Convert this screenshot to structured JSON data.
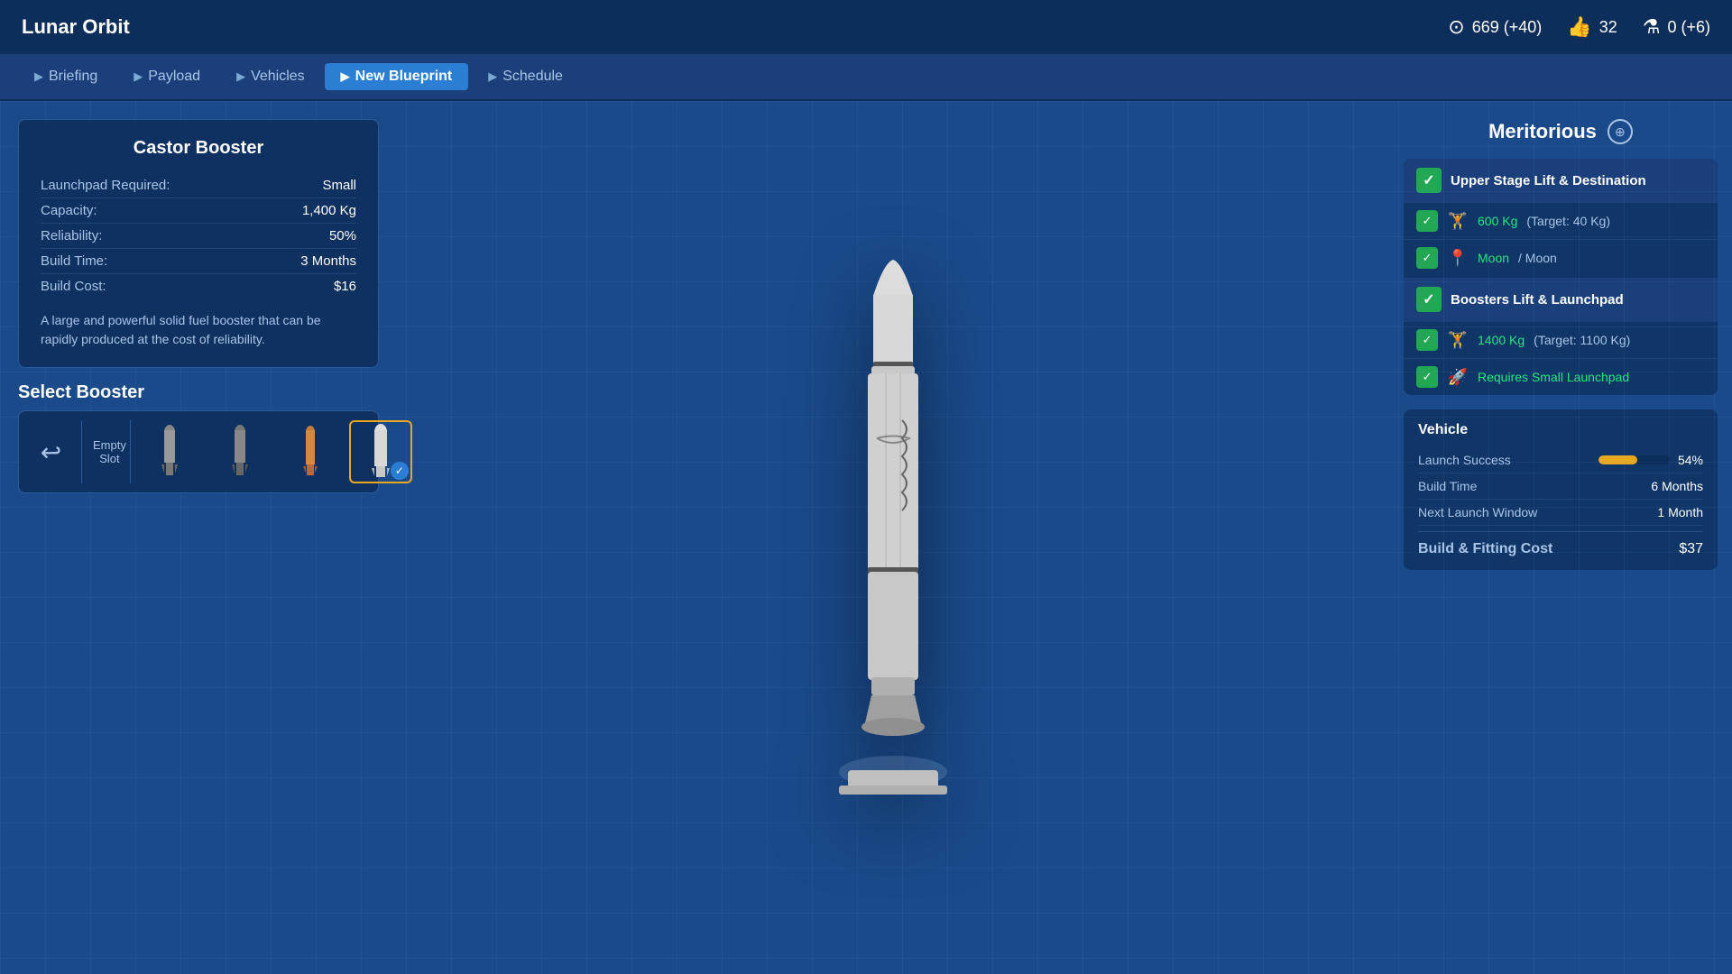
{
  "header": {
    "title": "Lunar Orbit",
    "resources": {
      "credits_icon": "⊙",
      "credits_value": "669 (+40)",
      "rep_icon": "👍",
      "rep_value": "32",
      "research_icon": "⚗",
      "research_value": "0 (+6)"
    }
  },
  "nav": {
    "items": [
      {
        "id": "briefing",
        "label": "Briefing",
        "active": false
      },
      {
        "id": "payload",
        "label": "Payload",
        "active": false
      },
      {
        "id": "vehicles",
        "label": "Vehicles",
        "active": false
      },
      {
        "id": "new-blueprint",
        "label": "New Blueprint",
        "active": true
      },
      {
        "id": "schedule",
        "label": "Schedule",
        "active": false
      }
    ]
  },
  "booster_info": {
    "title": "Castor Booster",
    "stats": [
      {
        "label": "Launchpad Required:",
        "value": "Small"
      },
      {
        "label": "Capacity:",
        "value": "1,400 Kg"
      },
      {
        "label": "Reliability:",
        "value": "50%"
      },
      {
        "label": "Build Time:",
        "value": "3 Months"
      },
      {
        "label": "Build Cost:",
        "value": "$16"
      }
    ],
    "description": "A large and powerful solid fuel booster that can be rapidly produced at the cost of reliability."
  },
  "select_booster": {
    "title": "Select Booster",
    "back_label": "↩",
    "empty_slot_label": "Empty Slot"
  },
  "mission_rating": {
    "title": "Meritorious",
    "info_icon": "⊕"
  },
  "requirements": [
    {
      "id": "upper-stage",
      "header": "Upper Stage Lift & Destination",
      "header_checked": true,
      "items": [
        {
          "icon": "🏋",
          "text": "600 Kg",
          "subtext": "(Target: 40 Kg)",
          "checked": true
        },
        {
          "icon": "📍",
          "text": "Moon",
          "subtext": "/ Moon",
          "checked": true
        }
      ]
    },
    {
      "id": "boosters",
      "header": "Boosters Lift & Launchpad",
      "header_checked": true,
      "items": [
        {
          "icon": "🏋",
          "text": "1400 Kg",
          "subtext": "(Target: 1100 Kg)",
          "checked": true
        },
        {
          "icon": "🚀",
          "text": "Requires Small Launchpad",
          "subtext": "",
          "checked": true
        }
      ]
    }
  ],
  "vehicle": {
    "title": "Vehicle",
    "stats": [
      {
        "label": "Launch Success",
        "value": "54%",
        "has_bar": true,
        "bar_pct": 54
      },
      {
        "label": "Build Time",
        "value": "6 Months",
        "has_bar": false
      },
      {
        "label": "Next Launch Window",
        "value": "1 Month",
        "has_bar": false
      }
    ],
    "build_cost_label": "Build & Fitting Cost",
    "build_cost_value": "$37"
  }
}
